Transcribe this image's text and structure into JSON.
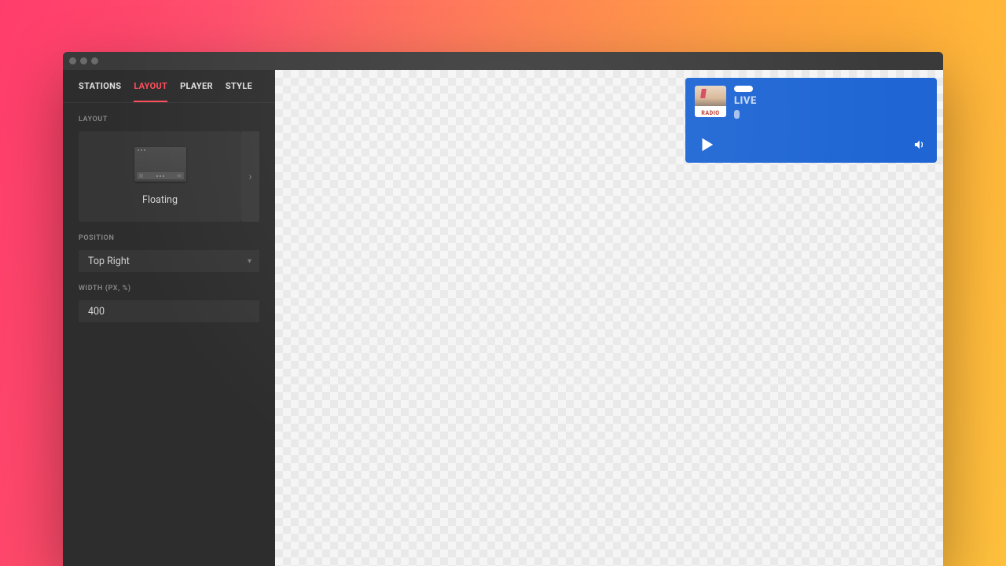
{
  "sidebar": {
    "tabs": [
      {
        "label": "STATIONS"
      },
      {
        "label": "LAYOUT"
      },
      {
        "label": "PLAYER"
      },
      {
        "label": "STYLE"
      }
    ],
    "active_tab_index": 1,
    "sections": {
      "layout": {
        "heading": "LAYOUT",
        "option_label": "Floating"
      },
      "position": {
        "heading": "POSITION",
        "value": "Top Right"
      },
      "width": {
        "heading": "WIDTH (PX, %)",
        "value": "400"
      }
    }
  },
  "player": {
    "status_label": "LIVE",
    "album_text": "RADIO",
    "accent_color": "#1f66d4"
  }
}
